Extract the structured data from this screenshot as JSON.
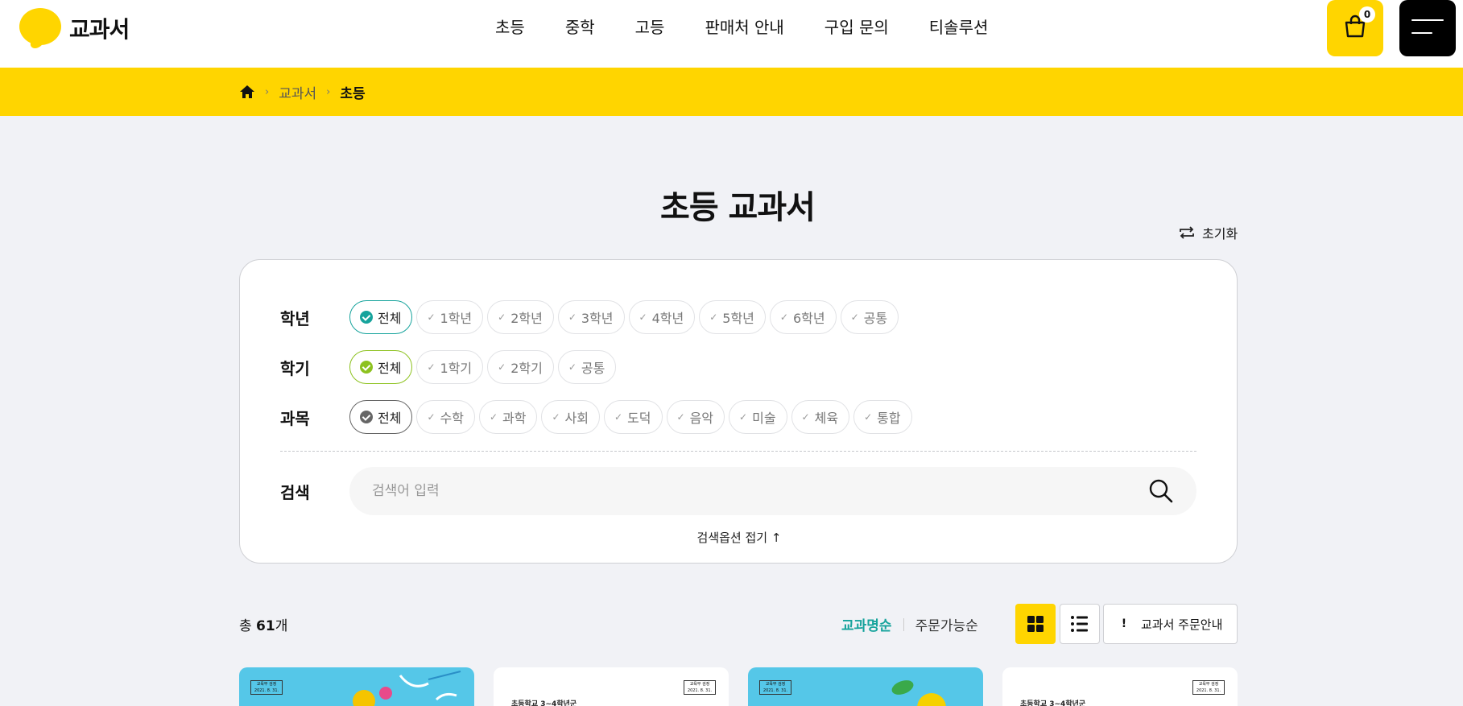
{
  "header": {
    "logo_text": "교과서",
    "nav": [
      "초등",
      "중학",
      "고등",
      "판매처 안내",
      "구입 문의",
      "티솔루션"
    ],
    "cart_count": "0"
  },
  "breadcrumb": {
    "items": [
      "교과서",
      "초등"
    ]
  },
  "page": {
    "title": "초등 교과서",
    "reset_label": "초기화"
  },
  "filters": {
    "grade": {
      "label": "학년",
      "options": [
        "전체",
        "1학년",
        "2학년",
        "3학년",
        "4학년",
        "5학년",
        "6학년",
        "공통"
      ],
      "selected": "전체"
    },
    "semester": {
      "label": "학기",
      "options": [
        "전체",
        "1학기",
        "2학기",
        "공통"
      ],
      "selected": "전체"
    },
    "subject": {
      "label": "과목",
      "options": [
        "전체",
        "수학",
        "과학",
        "사회",
        "도덕",
        "음악",
        "미술",
        "체육",
        "통합"
      ],
      "selected": "전체"
    },
    "search": {
      "label": "검색",
      "placeholder": "검색어 입력",
      "value": ""
    },
    "fold_label": "검색옵션 접기"
  },
  "results": {
    "total_prefix": "총",
    "total_count": "61",
    "total_suffix": "개",
    "sort_options": [
      "교과명순",
      "주문가능순"
    ],
    "sort_active": "교과명순",
    "order_guide_label": "교과서 주문안내"
  },
  "cards": [
    {
      "theme": "blue",
      "stamp": "교육부 검정\n2021. 8. 31."
    },
    {
      "theme": "white",
      "stamp": "교육부 검정\n2021. 8. 31.",
      "subtitle": "초등학교 3~4학년군"
    },
    {
      "theme": "blue",
      "stamp": "교육부 검정\n2021. 8. 31."
    },
    {
      "theme": "white",
      "stamp": "교육부 검정\n2021. 8. 31.",
      "subtitle": "초등학교 3~4학년군"
    }
  ],
  "colors": {
    "brand_yellow": "#ffd500",
    "accent_teal": "#16a39c",
    "accent_green": "#8dc21f",
    "page_bg": "#f1f2f6"
  }
}
